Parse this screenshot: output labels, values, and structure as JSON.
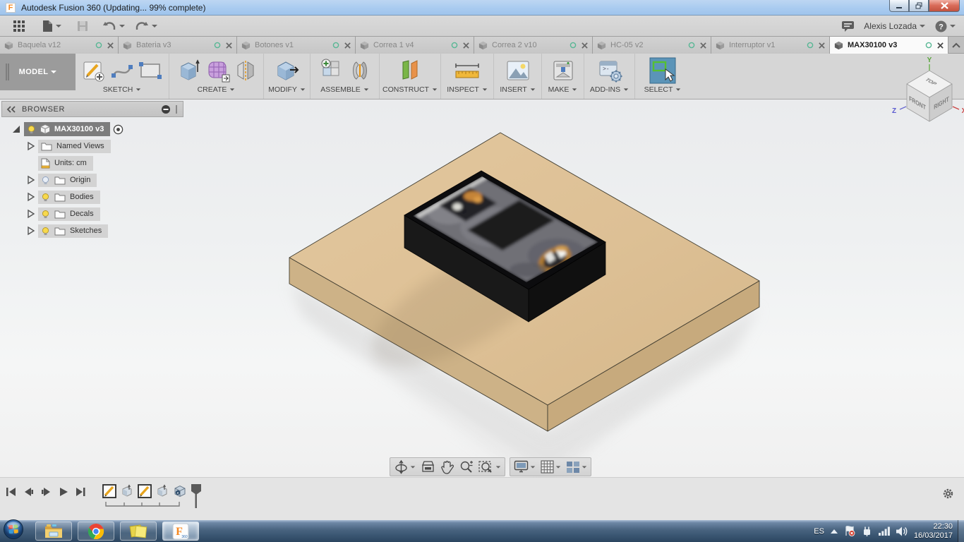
{
  "window": {
    "title": "Autodesk Fusion 360  (Updating... 99% complete)"
  },
  "header": {
    "user": "Alexis Lozada"
  },
  "tabs": [
    {
      "label": "Baquela v12"
    },
    {
      "label": "Bateria v3"
    },
    {
      "label": "Botones v1"
    },
    {
      "label": "Correa 1 v4"
    },
    {
      "label": "Correa 2 v10"
    },
    {
      "label": "HC-05 v2"
    },
    {
      "label": "Interruptor v1"
    },
    {
      "label": "MAX30100 v3"
    }
  ],
  "ribbon": {
    "workspace": "MODEL",
    "groups": [
      "SKETCH",
      "CREATE",
      "MODIFY",
      "ASSEMBLE",
      "CONSTRUCT",
      "INSPECT",
      "INSERT",
      "MAKE",
      "ADD-INS",
      "SELECT"
    ]
  },
  "browser": {
    "title": "BROWSER",
    "root": "MAX30100 v3",
    "items": [
      {
        "label": "Named Views"
      },
      {
        "label": "Units: cm"
      },
      {
        "label": "Origin"
      },
      {
        "label": "Bodies"
      },
      {
        "label": "Decals"
      },
      {
        "label": "Sketches"
      }
    ]
  },
  "viewcube": {
    "top": "TOP",
    "front": "FRONT",
    "right": "RIGHT",
    "x": "X",
    "y": "Y",
    "z": "Z"
  },
  "tray": {
    "language": "ES",
    "time": "22:30",
    "date": "16/03/2017"
  },
  "colors": {
    "board_top": "#dfc298",
    "board_left": "#cdb287",
    "board_right": "#c7aa7d",
    "chip_top": "#0c0c0e",
    "chip_left": "#191919",
    "chip_right": "#101010",
    "select_active": "#5b94b8",
    "titlebar": "#abccee"
  }
}
